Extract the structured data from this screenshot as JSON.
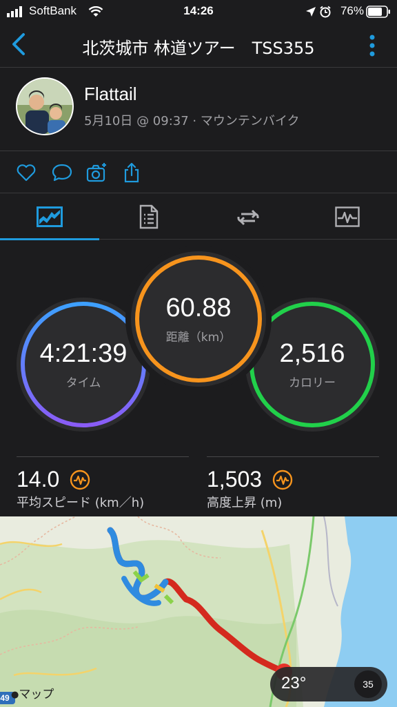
{
  "status_bar": {
    "carrier": "SoftBank",
    "time": "14:26",
    "battery": "76%"
  },
  "nav": {
    "title": "北茨城市 林道ツアー　TSS355"
  },
  "profile": {
    "name": "Flattail",
    "meta": "5月10日 @ 09:37 · マウンテンバイク"
  },
  "tabs": [
    {
      "name": "overview",
      "icon": "chart-icon"
    },
    {
      "name": "details",
      "icon": "document-icon"
    },
    {
      "name": "laps",
      "icon": "repeat-icon"
    },
    {
      "name": "stats",
      "icon": "activity-icon"
    }
  ],
  "rings": {
    "time": {
      "value": "4:21:39",
      "label": "タイム"
    },
    "distance": {
      "value": "60.88",
      "label": "距離（km）"
    },
    "calories": {
      "value": "2,516",
      "label": "カロリー"
    }
  },
  "metrics": {
    "avg_speed": {
      "value": "14.0",
      "label": "平均スピード (km／h)"
    },
    "elevation": {
      "value": "1,503",
      "label": "高度上昇 (m)"
    }
  },
  "map": {
    "attribution": "マップ",
    "road_number": "49",
    "weather_temp": "23°",
    "weather_index": "35"
  },
  "colors": {
    "accent": "#1f9bde",
    "orange": "#f7941d",
    "green": "#21d04a",
    "blue_purple_start": "#3da0ff",
    "blue_purple_end": "#8a5cf6"
  }
}
